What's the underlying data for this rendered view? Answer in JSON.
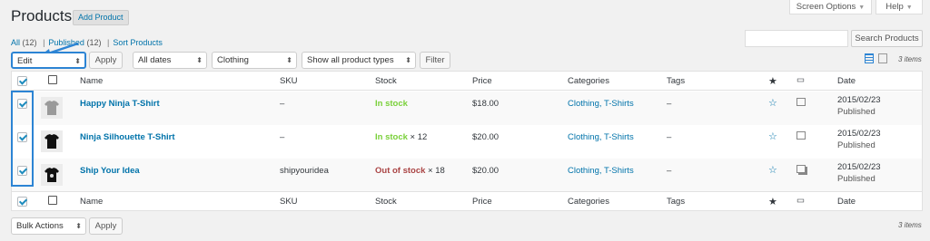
{
  "page": {
    "title": "Products",
    "add_button": "Add Product",
    "screen_options": "Screen Options",
    "help": "Help",
    "tab_caret": "▼"
  },
  "filters_nav": {
    "all_label": "All",
    "all_count": "(12)",
    "published_label": "Published",
    "published_count": "(12)",
    "sort_label": "Sort Products",
    "separator": "|"
  },
  "search": {
    "button": "Search Products",
    "value": ""
  },
  "toolbar": {
    "bulk_selected": "Edit",
    "apply": "Apply",
    "dates": "All dates",
    "category": "Clothing",
    "product_type": "Show all product types",
    "filter": "Filter",
    "caret": "⬍",
    "items_count": "3 items"
  },
  "columns": {
    "name": "Name",
    "sku": "SKU",
    "stock": "Stock",
    "price": "Price",
    "categories": "Categories",
    "tags": "Tags",
    "featured": "★",
    "type": "▭",
    "date": "Date"
  },
  "rows": [
    {
      "name": "Happy Ninja T-Shirt",
      "sku": "–",
      "stock": "In stock",
      "stock_qty": "",
      "price": "$18.00",
      "categories": "Clothing, T-Shirts",
      "tags": "–",
      "featured": "☆",
      "date": "2015/02/23",
      "status": "Published",
      "thumb": "grey-tshirt"
    },
    {
      "name": "Ninja Silhouette T-Shirt",
      "sku": "–",
      "stock": "In stock",
      "stock_qty": " × 12",
      "price": "$20.00",
      "categories": "Clothing, T-Shirts",
      "tags": "–",
      "featured": "☆",
      "date": "2015/02/23",
      "status": "Published",
      "thumb": "black-tshirt"
    },
    {
      "name": "Ship Your Idea",
      "sku": "shipyouridea",
      "stock": "Out of stock",
      "stock_qty": " × 18",
      "price": "$20.00",
      "categories": "Clothing, T-Shirts",
      "tags": "–",
      "featured": "☆",
      "date": "2015/02/23",
      "status": "Published",
      "thumb": "black-tshirt"
    }
  ],
  "bottom": {
    "bulk": "Bulk Actions",
    "apply": "Apply",
    "items_count": "3 items"
  },
  "colors": {
    "accent": "#2c84d4",
    "link": "#0073aa",
    "in_stock": "#7ad03a",
    "out_of_stock": "#aa4444"
  }
}
